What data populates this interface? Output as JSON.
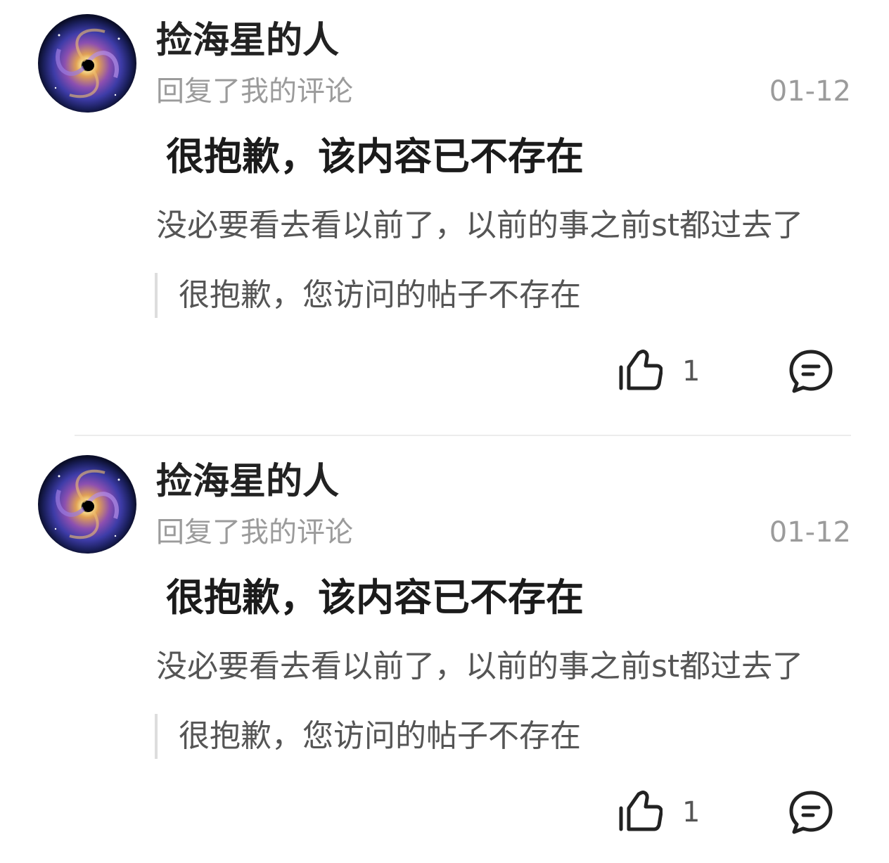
{
  "notifications": [
    {
      "username": "捡海星的人",
      "subtitle": "回复了我的评论",
      "date": "01-12",
      "reply_main": "很抱歉，该内容已不存在",
      "reply_text": "没必要看去看以前了，以前的事之前st都过去了",
      "quoted": "很抱歉，您访问的帖子不存在",
      "like_count": "1"
    },
    {
      "username": "捡海星的人",
      "subtitle": "回复了我的评论",
      "date": "01-12",
      "reply_main": "很抱歉，该内容已不存在",
      "reply_text": "没必要看去看以前了，以前的事之前st都过去了",
      "quoted": "很抱歉，您访问的帖子不存在",
      "like_count": "1"
    }
  ],
  "icons": {
    "like": "thumbs-up-icon",
    "comment": "comment-bubble-icon"
  },
  "colors": {
    "primary_text": "#222222",
    "secondary_text": "#9b9b9b",
    "body_text": "#555555",
    "quote_bar": "#dddddd"
  }
}
